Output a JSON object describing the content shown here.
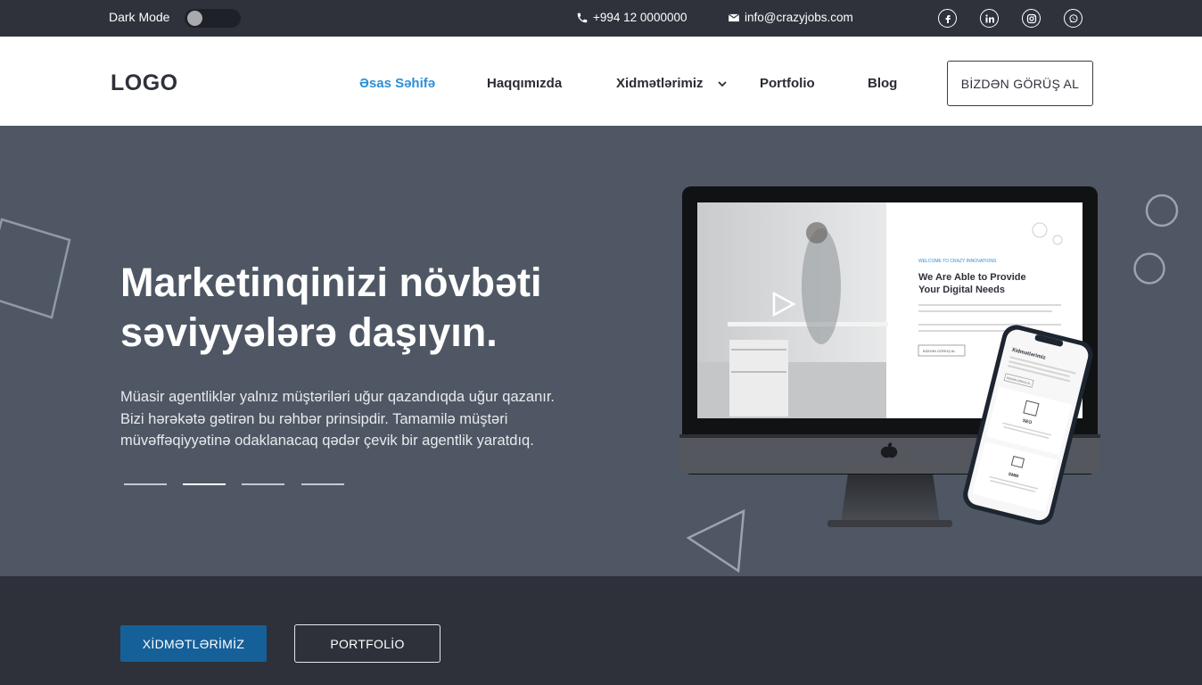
{
  "topbar": {
    "dark_mode_label": "Dark Mode",
    "dark_mode_on": false,
    "phone": "+994 12 0000000",
    "email": "info@crazyjobs.com",
    "social_icons": [
      "facebook-icon",
      "linkedin-icon",
      "instagram-icon",
      "whatsapp-icon"
    ]
  },
  "header": {
    "logo": "LOGO",
    "nav": [
      {
        "label": "Əsas Səhifə",
        "active": true
      },
      {
        "label": "Haqqımızda",
        "active": false
      },
      {
        "label": "Xidmətlərimiz",
        "active": false,
        "has_dropdown": true
      },
      {
        "label": "Portfolio",
        "active": false
      },
      {
        "label": "Blog",
        "active": false
      }
    ],
    "cta_label": "BİZDƏN GÖRÜŞ AL"
  },
  "hero": {
    "title_lines": [
      "Marketinqinizi növbəti",
      "səviyyələrə daşıyın."
    ],
    "text_lines": [
      "Müasir agentliklər yalnız müştəriləri uğur qazandıqda uğur qazanır.",
      "Bizi hərəkətə gətirən bu rəhbər prinsipdir. Tamamilə müştəri",
      "müvəffəqiyyətinə odaklanacaq qədər çevik bir agentlik yaratdıq."
    ],
    "slider_count": 4,
    "slider_active_index": 1,
    "mockup": {
      "desktop_eyebrow": "WELCOME TO CRAZY INNOVATIONS",
      "desktop_heading_lines": [
        "We Are Able to Provide",
        "Your Digital Needs"
      ],
      "desktop_para1": "Code is a company of specialists in design, technology, product delivery, business strategy and coaching.",
      "desktop_para2": "We wrap cross-disciplinary teams around our clients to drive the outcomes you need to succeed.",
      "desktop_button": "BİZDƏN GÖRÜŞ AL",
      "phone_title": "Xidmətlərimiz",
      "phone_button": "BİZDƏN GÖRÜŞ AL",
      "phone_service1": "SEO",
      "phone_service2": "SMM"
    }
  },
  "actions": {
    "primary_label": "XİDMƏTLƏRİMİZ",
    "secondary_label": "PORTFOLİO"
  },
  "colors": {
    "topbar_bg": "#2f323b",
    "hero_bg": "#4f5764",
    "bottom_bg": "#2e313a",
    "active_nav": "#2a8fd8",
    "primary_button": "#16609a"
  }
}
